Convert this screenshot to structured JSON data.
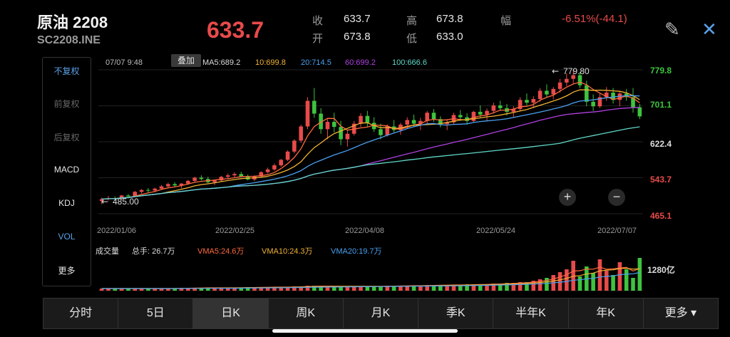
{
  "header": {
    "symbol": "原油 2208",
    "code": "SC2208.INE",
    "price": "633.7"
  },
  "quote": {
    "close_label": "收",
    "close_value": "633.7",
    "open_label": "开",
    "open_value": "673.8",
    "high_label": "高",
    "high_value": "673.8",
    "low_label": "低",
    "low_value": "633.0",
    "range_label": "幅",
    "change": "-6.51%(-44.1)"
  },
  "icons": {
    "edit": "✎",
    "close": "✕"
  },
  "sidebar": [
    "不复权",
    "前复权",
    "后复权",
    "MACD",
    "KDJ",
    "VOL",
    "更多"
  ],
  "chart_meta": {
    "datetime": "07/07 9:48",
    "overlay_label": "叠加",
    "ma5": "MA5:689.2",
    "ma10": "10:699.8",
    "ma20": "20:714.5",
    "ma60": "60:699.2",
    "ma100": "100:666.6"
  },
  "chart_data": {
    "type": "candlestick",
    "y_ticks": [
      "779.8",
      "701.1",
      "622.4",
      "543.7",
      "465.1"
    ],
    "x_ticks": [
      "2022/01/06",
      "2022/02/25",
      "2022/04/08",
      "2022/05/24",
      "2022/07/07"
    ],
    "ylim": [
      465.1,
      779.8
    ],
    "max_marker": "779.80",
    "min_marker": "485.00",
    "candles": [
      [
        493,
        500,
        486,
        497
      ],
      [
        497,
        504,
        494,
        499
      ],
      [
        499,
        503,
        494,
        498
      ],
      [
        498,
        506,
        496,
        505
      ],
      [
        505,
        508,
        499,
        503
      ],
      [
        503,
        515,
        502,
        513
      ],
      [
        513,
        519,
        509,
        517
      ],
      [
        517,
        521,
        511,
        516
      ],
      [
        516,
        522,
        512,
        520
      ],
      [
        520,
        528,
        518,
        525
      ],
      [
        525,
        533,
        522,
        530
      ],
      [
        530,
        534,
        524,
        527
      ],
      [
        527,
        532,
        521,
        531
      ],
      [
        531,
        539,
        528,
        537
      ],
      [
        537,
        546,
        535,
        544
      ],
      [
        544,
        549,
        538,
        541
      ],
      [
        541,
        546,
        532,
        534
      ],
      [
        534,
        540,
        528,
        538
      ],
      [
        538,
        548,
        536,
        546
      ],
      [
        546,
        553,
        541,
        549
      ],
      [
        549,
        556,
        544,
        552
      ],
      [
        552,
        557,
        545,
        547
      ],
      [
        547,
        551,
        538,
        540
      ],
      [
        540,
        549,
        536,
        547
      ],
      [
        547,
        558,
        545,
        556
      ],
      [
        556,
        566,
        553,
        562
      ],
      [
        562,
        575,
        559,
        571
      ],
      [
        571,
        585,
        568,
        583
      ],
      [
        583,
        604,
        580,
        601
      ],
      [
        601,
        628,
        597,
        625
      ],
      [
        625,
        660,
        620,
        656
      ],
      [
        656,
        720,
        650,
        712
      ],
      [
        712,
        740,
        675,
        684
      ],
      [
        684,
        696,
        640,
        650
      ],
      [
        650,
        672,
        628,
        666
      ],
      [
        666,
        686,
        643,
        655
      ],
      [
        655,
        668,
        615,
        628
      ],
      [
        628,
        648,
        612,
        640
      ],
      [
        640,
        668,
        636,
        662
      ],
      [
        662,
        685,
        655,
        679
      ],
      [
        679,
        690,
        656,
        664
      ],
      [
        664,
        676,
        644,
        650
      ],
      [
        650,
        662,
        628,
        637
      ],
      [
        637,
        660,
        634,
        656
      ],
      [
        656,
        670,
        643,
        648
      ],
      [
        648,
        664,
        638,
        660
      ],
      [
        660,
        676,
        652,
        670
      ],
      [
        670,
        682,
        655,
        662
      ],
      [
        662,
        675,
        648,
        668
      ],
      [
        668,
        690,
        660,
        686
      ],
      [
        686,
        694,
        666,
        672
      ],
      [
        672,
        678,
        654,
        661
      ],
      [
        661,
        672,
        648,
        665
      ],
      [
        665,
        686,
        660,
        681
      ],
      [
        681,
        692,
        668,
        676
      ],
      [
        676,
        685,
        660,
        668
      ],
      [
        668,
        690,
        664,
        688
      ],
      [
        688,
        702,
        676,
        682
      ],
      [
        682,
        695,
        668,
        690
      ],
      [
        690,
        708,
        684,
        702
      ],
      [
        702,
        712,
        690,
        696
      ],
      [
        696,
        705,
        680,
        688
      ],
      [
        688,
        700,
        676,
        694
      ],
      [
        694,
        720,
        690,
        714
      ],
      [
        714,
        728,
        702,
        708
      ],
      [
        708,
        722,
        696,
        716
      ],
      [
        716,
        740,
        710,
        734
      ],
      [
        734,
        748,
        720,
        726
      ],
      [
        726,
        742,
        715,
        738
      ],
      [
        738,
        760,
        730,
        752
      ],
      [
        752,
        772,
        744,
        760
      ],
      [
        760,
        780,
        750,
        768
      ],
      [
        768,
        775,
        740,
        746
      ],
      [
        746,
        756,
        700,
        710
      ],
      [
        710,
        726,
        690,
        700
      ],
      [
        700,
        728,
        696,
        720
      ],
      [
        720,
        742,
        712,
        730
      ],
      [
        730,
        740,
        706,
        714
      ],
      [
        714,
        732,
        700,
        728
      ],
      [
        728,
        738,
        712,
        720
      ],
      [
        720,
        740,
        686,
        698
      ],
      [
        698,
        705,
        672,
        678
      ]
    ],
    "volume_label": "成交量",
    "total_volume": "总手: 26.7万",
    "vma5": "VMA5:24.6万",
    "vma10": "VMA10:24.3万",
    "vma20": "VMA20:19.7万",
    "volume_tick": "1280亿",
    "volumes": [
      3,
      3,
      3,
      3,
      3,
      3,
      3,
      3,
      3,
      3,
      3,
      3,
      4,
      4,
      4,
      4,
      4,
      4,
      4,
      4,
      4,
      4,
      5,
      5,
      5,
      5,
      5,
      5,
      5,
      6,
      6,
      7,
      7,
      6,
      6,
      6,
      6,
      6,
      6,
      6,
      6,
      6,
      6,
      7,
      7,
      7,
      7,
      7,
      7,
      8,
      8,
      8,
      8,
      8,
      8,
      9,
      9,
      9,
      9,
      10,
      10,
      11,
      11,
      12,
      12,
      14,
      16,
      18,
      22,
      26,
      30,
      42,
      20,
      34,
      25,
      44,
      28,
      22,
      40,
      30,
      18,
      46
    ]
  },
  "zoom": {
    "in": "+",
    "out": "−"
  },
  "tabs": [
    "分时",
    "5日",
    "日K",
    "周K",
    "月K",
    "季K",
    "半年K",
    "年K",
    "更多 ▾"
  ],
  "colors": {
    "up": "#e84a4a",
    "down": "#3ec33e",
    "ma5": "#ff6a3d",
    "ma10": "#f2b233",
    "ma20": "#4aa0f0",
    "ma60": "#b040e0",
    "ma100": "#5fd8c8"
  }
}
